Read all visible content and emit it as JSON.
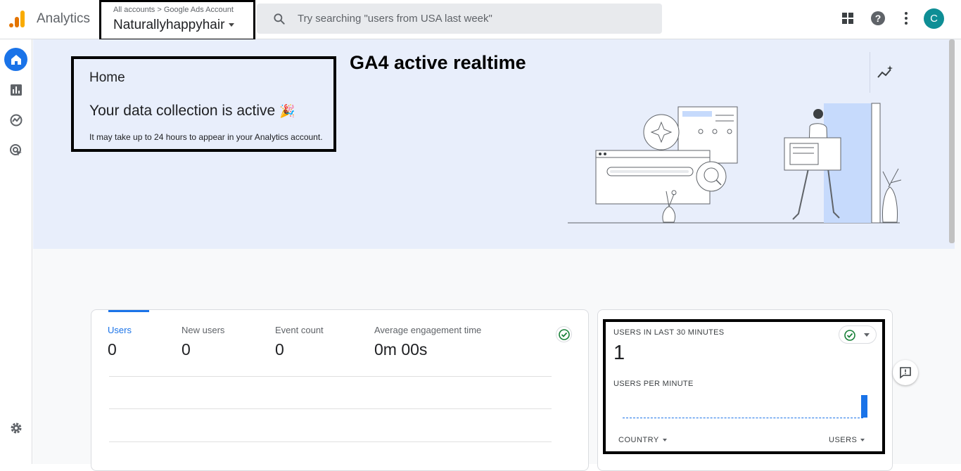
{
  "header": {
    "app_name": "Analytics",
    "breadcrumb": "All accounts > Google Ads Account",
    "property_name": "Naturallyhappyhair",
    "search_placeholder": "Try searching \"users from USA last week\"",
    "avatar_initial": "C",
    "avatar_color": "#0e8e95"
  },
  "sidebar": {
    "items": [
      {
        "name": "home",
        "icon": "home-icon",
        "active": true
      },
      {
        "name": "reports",
        "icon": "bar-chart-icon"
      },
      {
        "name": "explore",
        "icon": "explore-icon"
      },
      {
        "name": "advertising",
        "icon": "advertising-icon"
      }
    ],
    "footer_icon": "gear-icon"
  },
  "hero": {
    "title": "Home",
    "message": "Your data collection is active",
    "emoji": "🎉",
    "subtext": "It may take up to 24 hours to appear in your Analytics account.",
    "annotation": "GA4 active realtime"
  },
  "metrics": {
    "tabs": [
      {
        "label": "Users",
        "value": "0",
        "active": true
      },
      {
        "label": "New users",
        "value": "0"
      },
      {
        "label": "Event count",
        "value": "0"
      },
      {
        "label": "Average engagement time",
        "value": "0m 00s"
      }
    ]
  },
  "realtime": {
    "label": "USERS IN LAST 30 MINUTES",
    "value": "1",
    "per_minute_label": "USERS PER MINUTE",
    "country_label": "COUNTRY",
    "users_label": "USERS"
  },
  "colors": {
    "accent": "#1a73e8",
    "hero_bg": "#e8eefb",
    "success": "#188038"
  }
}
